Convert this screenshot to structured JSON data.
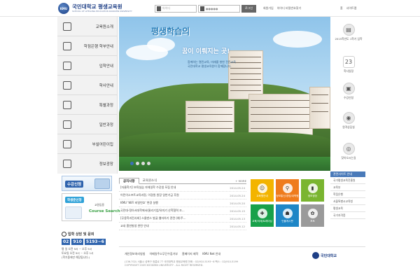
{
  "header": {
    "logo_mark": "KMU",
    "logo_title": "국민대학교 평생교육원",
    "logo_subtitle": "SCHOOL OF LIFELONG EDUCATION KOOKMIN UNIVERSITY",
    "id_placeholder": "아이디",
    "pw_value": "●●●●●",
    "login_label": "로그인",
    "links": [
      "회원가입",
      "아이디 비밀번호찾기"
    ],
    "links_right": [
      "홈",
      "사이트맵"
    ]
  },
  "left_nav": [
    "교육원소개",
    "학점은행 학부안내",
    "입학안내",
    "학사안내",
    "특별과정",
    "일반과정",
    "부설어린이집",
    "정보광장"
  ],
  "hero": {
    "title": "평생학습의",
    "title2": "꿈이 이뤄지는 곳!",
    "subtitle": [
      "함께하는 열린교육, 미래를 향한 전문교육",
      "국민대학교 평생교육원이 함께합니다."
    ]
  },
  "quick_right": [
    {
      "label": "2015학년도 1학기 입학",
      "icon": "doc-icon",
      "glyph": "▤"
    },
    {
      "label": "학사일정",
      "icon": "calendar-icon",
      "glyph": "23"
    },
    {
      "label": "수강신청",
      "icon": "monitor-icon",
      "glyph": "▣"
    },
    {
      "label": "원격상담실",
      "icon": "chat-icon",
      "glyph": "◉"
    },
    {
      "label": "찾아오시는길",
      "icon": "map-icon",
      "glyph": "◎"
    }
  ],
  "right_links": {
    "header": "관련사이트 안내",
    "items": [
      "국가평생교육진흥원",
      "교육부",
      "학점은행",
      "서울특별시교육청",
      "평생교육",
      "국가자격증"
    ]
  },
  "apply": {
    "label": "수강신청"
  },
  "course": {
    "label1": "학생준신청",
    "label2": "교원임용",
    "title": "Course Search"
  },
  "phone": {
    "title": "입학 상담 및 문의",
    "parts": [
      "02",
      "910",
      "5193~6"
    ],
    "rows": [
      "평 일 오전 9시 ~ 오후 5시",
      "토요일 오전 9시 ~ 오후 1시",
      "(학기중에만 해당됩니다.)"
    ]
  },
  "notice": {
    "tabs": [
      "공지사항",
      "교육원소식"
    ],
    "more": "+ MORE",
    "rows": [
      {
        "title": "[자율학기] 보육실습 자체일학 수강생 모집 안내",
        "date": "2014.05.24"
      },
      {
        "title": "어린이소프트교육과정, 이경원 원장 일반기금 후원",
        "date": "2014.05.24"
      },
      {
        "title": "KMU 'WiFi 비밀번호' 변경 실행",
        "date": "2014.05.20"
      },
      {
        "title": "국민대-정아서대학에서(물리기업/유미기 산학협력 조...",
        "date": "2014.05.15"
      },
      {
        "title": "[무용학과전사회] 스물덴스 발굴 웹자하기 관련 (예:주...",
        "date": "2014.05.13"
      },
      {
        "title": "교내 흡연발생 관련 안내",
        "date": "2014.05.12"
      }
    ]
  },
  "tiles": [
    {
      "label": "교육원안내",
      "color": "#f3b400",
      "glyph": "☺"
    },
    {
      "label": "정보통신/경영/대학원",
      "color": "#ef7b1c",
      "glyph": "⚲"
    },
    {
      "label": "정보광장",
      "color": "#7ab530",
      "glyph": "▮"
    },
    {
      "label": "교육/국제/트레이닝",
      "color": "#18a14a",
      "glyph": "✚"
    },
    {
      "label": "인물게시판",
      "color": "#1e86c6",
      "glyph": "☗"
    },
    {
      "label": "포토",
      "color": "#9a9a9a",
      "glyph": "✿"
    }
  ],
  "footer": {
    "links": [
      "개인정보처리방침",
      "이메일주소무단수집거부",
      "홈페이지 제작",
      "KMU Net 안내"
    ],
    "addr": [
      "(136-702) 서울시 성북구 정릉로 77 국민대학교 평생교육원  전화 : 02)910-5193~6  팩스 : 02)910-5199",
      "COPYRIGHT 2009 KOOKMIN UNIVERSITY . ALL RIGHT RESERVED."
    ],
    "logo_text": "국민대학교"
  }
}
